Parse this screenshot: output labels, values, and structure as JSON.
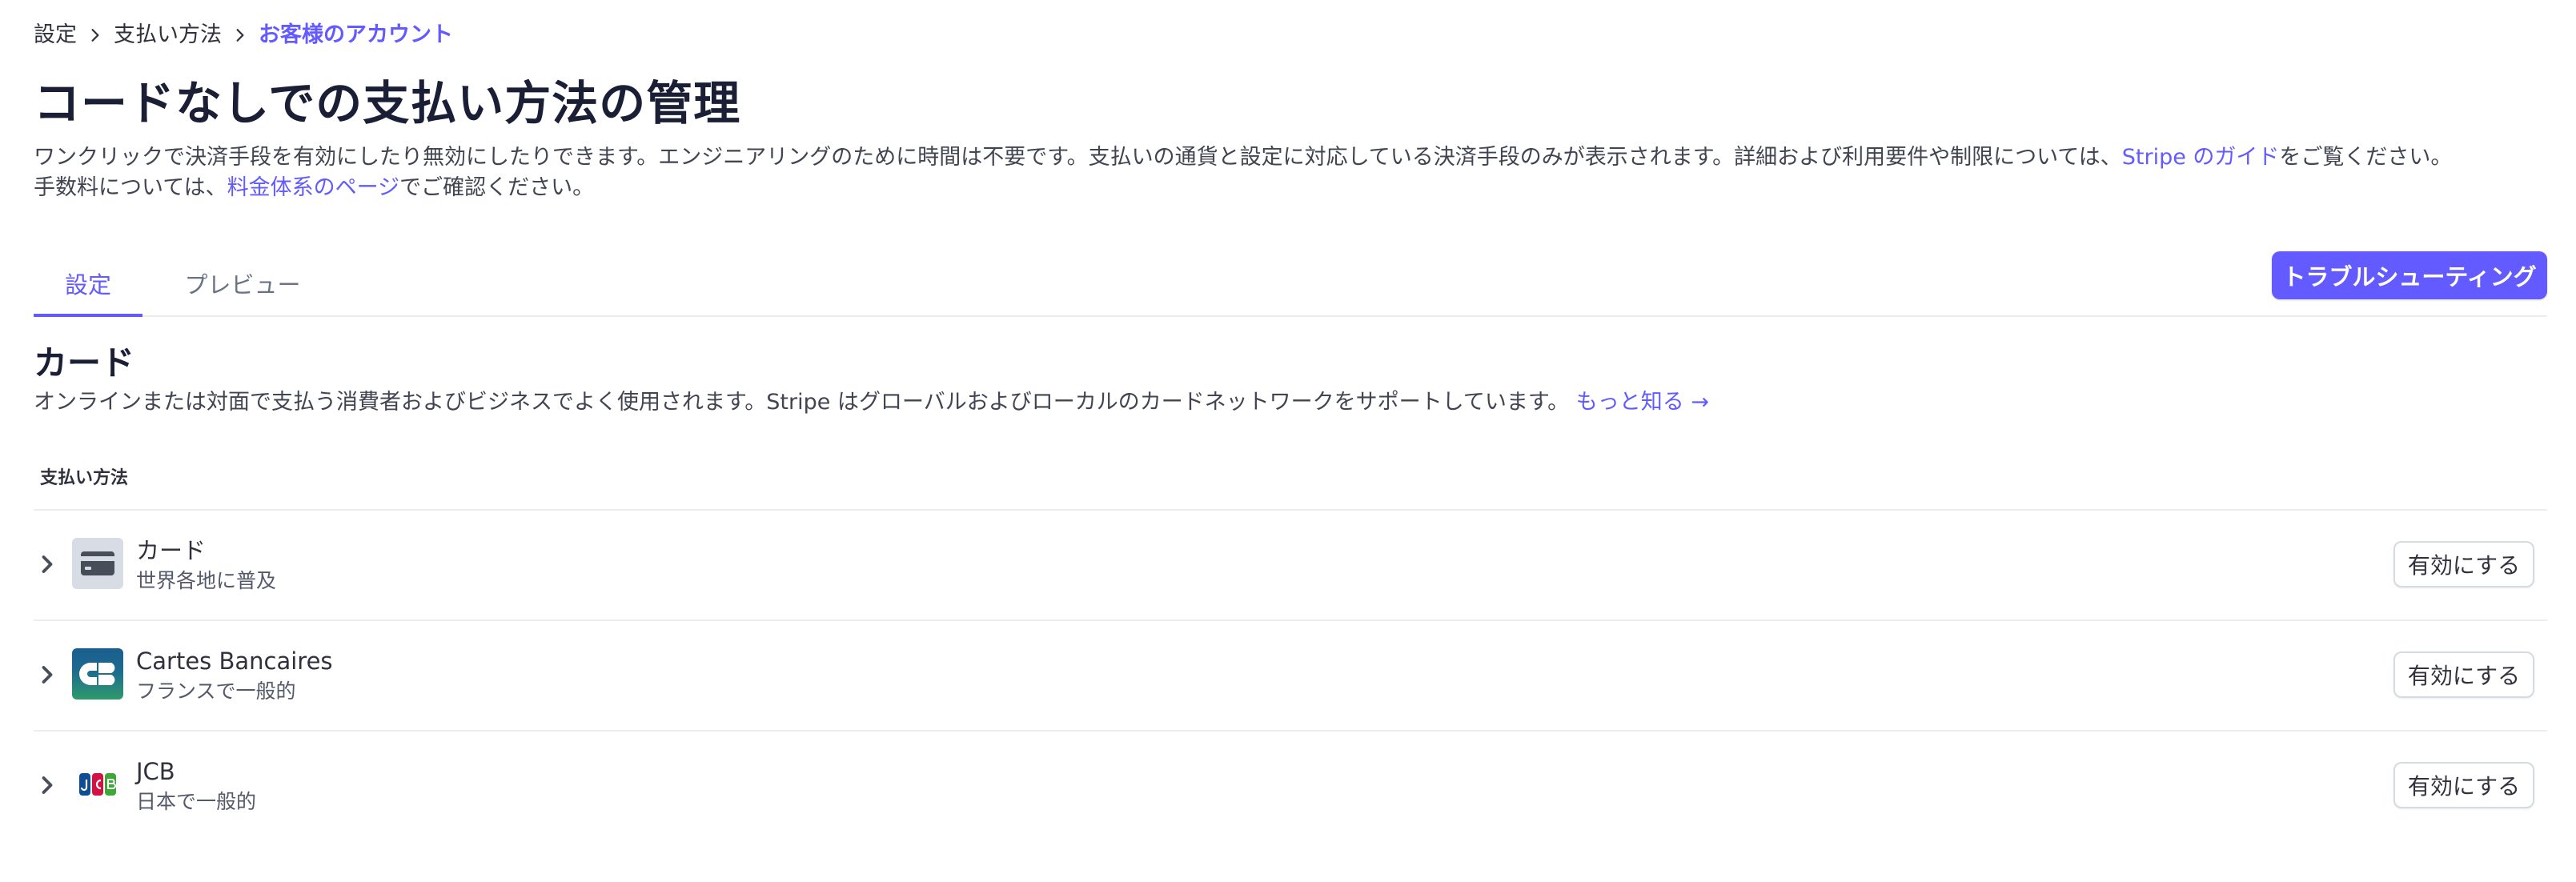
{
  "breadcrumb": {
    "items": [
      "設定",
      "支払い方法"
    ],
    "current": "お客様のアカウント"
  },
  "page": {
    "title": "コードなしでの支払い方法の管理",
    "description_part1": "ワンクリックで決済手段を有効にしたり無効にしたりできます。エンジニアリングのために時間は不要です。支払いの通貨と設定に対応している決済手段のみが表示されます。詳細および利用要件や制限については、",
    "description_link1": "Stripe のガイド",
    "description_part2": "をご覧ください。",
    "description_part3": "手数料については、",
    "description_link2": "料金体系のページ",
    "description_part4": "でご確認ください。"
  },
  "tabs": [
    {
      "label": "設定",
      "active": true
    },
    {
      "label": "プレビュー",
      "active": false
    }
  ],
  "toolbar": {
    "troubleshoot_label": "トラブルシューティング"
  },
  "section": {
    "title": "カード",
    "description": "オンラインまたは対面で支払う消費者およびビジネスでよく使用されます。Stripe はグローバルおよびローカルのカードネットワークをサポートしています。",
    "learn_more": "もっと知る →",
    "table_header": "支払い方法"
  },
  "methods": [
    {
      "name": "カード",
      "sub": "世界各地に普及",
      "button": "有効にする",
      "icon": "credit-card-icon"
    },
    {
      "name": "Cartes Bancaires",
      "sub": "フランスで一般的",
      "button": "有効にする",
      "icon": "cartes-bancaires-logo"
    },
    {
      "name": "JCB",
      "sub": "日本で一般的",
      "button": "有効にする",
      "icon": "jcb-logo"
    }
  ],
  "colors": {
    "accent": "#635bff",
    "text": "#1a1f36",
    "border": "#ebeef1"
  }
}
